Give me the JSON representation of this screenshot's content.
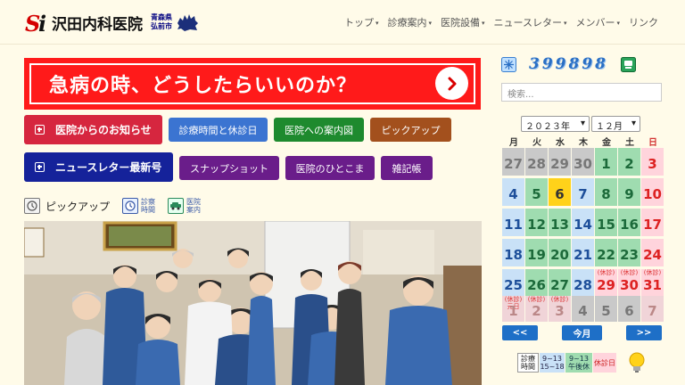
{
  "header": {
    "logo_letters": "Si",
    "site_name": "沢田内科医院",
    "location_line1": "青森県",
    "location_line2": "弘前市"
  },
  "nav": [
    {
      "label": "トップ",
      "has_menu": true,
      "active": true
    },
    {
      "label": "診療案内",
      "has_menu": true,
      "active": false
    },
    {
      "label": "医院設備",
      "has_menu": true,
      "active": false
    },
    {
      "label": "ニュースレター",
      "has_menu": true,
      "active": false
    },
    {
      "label": "メンバー",
      "has_menu": true,
      "active": false
    },
    {
      "label": "リンク",
      "has_menu": false,
      "active": false
    }
  ],
  "banner": {
    "text": "急病の時、どうしたらいいのか？"
  },
  "buttons_row1": [
    {
      "label": "医院からのお知らせ",
      "color": "#d6263f"
    },
    {
      "label": "診療時間と休診日",
      "color": "#3b74d1"
    },
    {
      "label": "医院への案内図",
      "color": "#1e8a2e"
    },
    {
      "label": "ピックアップ",
      "color": "#a3501d"
    }
  ],
  "buttons_row2": [
    {
      "label": "ニュースレター最新号",
      "color": "#15229a"
    },
    {
      "label": "スナップショット",
      "color": "#6a1d8a"
    },
    {
      "label": "医院のひとこま",
      "color": "#6a1d8a"
    },
    {
      "label": "雑記帳",
      "color": "#6a1d8a"
    }
  ],
  "pickup": {
    "label": "ピックアップ",
    "hours_link_line1": "診察",
    "hours_link_line2": "時間",
    "map_link_line1": "医院",
    "map_link_line2": "案内"
  },
  "counter": {
    "value": "399898"
  },
  "search": {
    "placeholder": "検索..."
  },
  "calendar": {
    "year_select": "２０２３年",
    "month_select": "１２月",
    "weekdays": [
      "月",
      "火",
      "水",
      "木",
      "金",
      "土",
      "日"
    ],
    "weekday_colors": [
      "#333333",
      "#333333",
      "#333333",
      "#333333",
      "#333333",
      "#333333",
      "#d33333"
    ],
    "weeks": [
      [
        {
          "d": "27",
          "k": "out"
        },
        {
          "d": "28",
          "k": "out"
        },
        {
          "d": "29",
          "k": "out"
        },
        {
          "d": "30",
          "k": "out"
        },
        {
          "d": "1",
          "k": "wk"
        },
        {
          "d": "2",
          "k": "wk"
        },
        {
          "d": "3",
          "k": "sun"
        }
      ],
      [
        {
          "d": "4",
          "k": "mon"
        },
        {
          "d": "5",
          "k": "wk"
        },
        {
          "d": "6",
          "k": "today"
        },
        {
          "d": "7",
          "k": "thu"
        },
        {
          "d": "8",
          "k": "wk"
        },
        {
          "d": "9",
          "k": "wk"
        },
        {
          "d": "10",
          "k": "sun"
        }
      ],
      [
        {
          "d": "11",
          "k": "mon"
        },
        {
          "d": "12",
          "k": "wk"
        },
        {
          "d": "13",
          "k": "wk"
        },
        {
          "d": "14",
          "k": "thu"
        },
        {
          "d": "15",
          "k": "wk"
        },
        {
          "d": "16",
          "k": "wk"
        },
        {
          "d": "17",
          "k": "sun"
        }
      ],
      [
        {
          "d": "18",
          "k": "mon"
        },
        {
          "d": "19",
          "k": "wk"
        },
        {
          "d": "20",
          "k": "wk"
        },
        {
          "d": "21",
          "k": "thu"
        },
        {
          "d": "22",
          "k": "wk"
        },
        {
          "d": "23",
          "k": "wk"
        },
        {
          "d": "24",
          "k": "sun"
        }
      ],
      [
        {
          "d": "25",
          "k": "mon"
        },
        {
          "d": "26",
          "k": "wk"
        },
        {
          "d": "27",
          "k": "wk"
        },
        {
          "d": "28",
          "k": "thu"
        },
        {
          "d": "29",
          "k": "hol",
          "t": "(休診)"
        },
        {
          "d": "30",
          "k": "hol",
          "t": "(休診)"
        },
        {
          "d": "31",
          "k": "hol",
          "t": "(休診)"
        }
      ],
      [
        {
          "d": "1",
          "k": "holout",
          "t": "(休診)元日"
        },
        {
          "d": "2",
          "k": "holout",
          "t": "(休診)"
        },
        {
          "d": "3",
          "k": "holout",
          "t": "(休診)"
        },
        {
          "d": "4",
          "k": "out"
        },
        {
          "d": "5",
          "k": "out"
        },
        {
          "d": "6",
          "k": "out"
        },
        {
          "d": "7",
          "k": "holout"
        }
      ]
    ],
    "prev_label": "<<",
    "today_label": "今月",
    "next_label": ">>"
  },
  "legend": {
    "title_line1": "診療",
    "title_line2": "時間",
    "full_line1": "9~13",
    "full_line2": "15~18",
    "half_line1": "9~13",
    "half_line2": "午後休",
    "closed": "休診日"
  }
}
